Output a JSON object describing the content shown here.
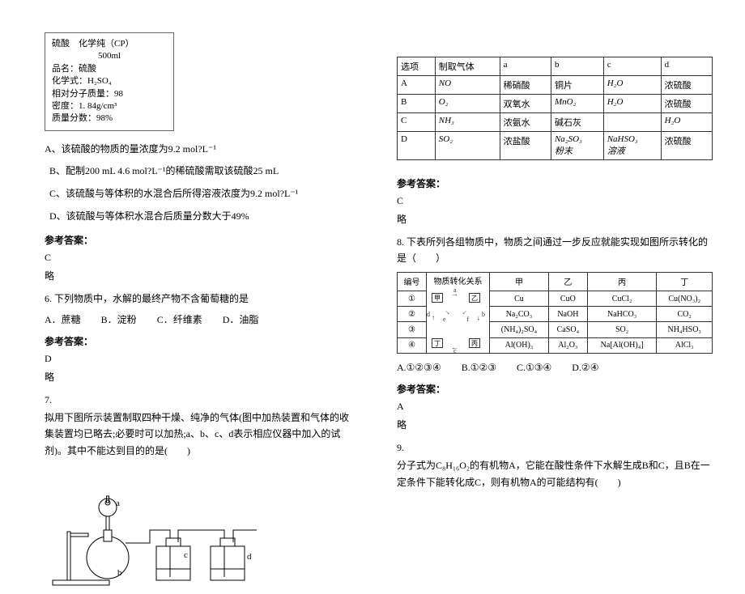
{
  "label_box": {
    "l1": "硫酸　化学纯（CP）",
    "l2": "500ml",
    "l3": "品名：硫酸",
    "l4": "化学式：H₂SO₄",
    "l5": "相对分子质量：98",
    "l6": "密度：1. 84g/cm³",
    "l7": "质量分数：98%"
  },
  "q5": {
    "A": "A、该硫酸的物质的量浓度为9.2 mol?L⁻¹",
    "B": "B、配制200 mL 4.6 mol?L⁻¹的稀硫酸需取该硫酸25 mL",
    "C": "C、该硫酸与等体积的水混合后所得溶液浓度为9.2 mol?L⁻¹",
    "D": "D、该硫酸与等体积水混合后质量分数大于49%",
    "ans_label": "参考答案：",
    "ans": "C",
    "skip": "略"
  },
  "q6": {
    "text": "6. 下列物质中，水解的最终产物不含葡萄糖的是",
    "A": "A．蔗糖",
    "B": "B．淀粉",
    "C": "C．纤维素",
    "D": "D．油脂",
    "ans_label": "参考答案：",
    "ans": "D",
    "skip": "略"
  },
  "q7": {
    "num": "7.",
    "text": "拟用下图所示装置制取四种干燥、纯净的气体(图中加热装置和气体的收集装置均已略去;必要时可以加热;a、b、c、d表示相应仪器中加入的试剂)。其中不能达到目的的是(　　)"
  },
  "gas_table": {
    "h0": "选项",
    "h1": "制取气体",
    "h2": "a",
    "h3": "b",
    "h4": "c",
    "h5": "d",
    "rows": [
      {
        "c0": "A",
        "c1": "NO",
        "c2": "稀硝酸",
        "c3": "铜片",
        "c4": "H₂O",
        "c5": "浓硫酸"
      },
      {
        "c0": "B",
        "c1": "O₂",
        "c2": "双氧水",
        "c3": "MnO₂",
        "c4": "H₂O",
        "c5": "浓硫酸"
      },
      {
        "c0": "C",
        "c1": "NH₃",
        "c2": "浓氨水",
        "c3": "碱石灰",
        "c4": "",
        "c5": "H₂O"
      },
      {
        "c0": "D",
        "c1": "SO₂",
        "c2": "浓盐酸",
        "c3": "Na₂SO₃\n粉末",
        "c4": "NaHSO₃\n溶液",
        "c5": "浓硫酸"
      }
    ],
    "ans_label": "参考答案：",
    "ans": "C",
    "skip": "略"
  },
  "q8": {
    "text": "8. 下表所列各组物质中，物质之间通过一步反应就能实现如图所示转化的是（　　）",
    "headers": {
      "h0": "编号",
      "h1": "物质转化关系",
      "h2": "甲",
      "h3": "乙",
      "h4": "丙",
      "h5": "丁"
    },
    "diagram": {
      "jia": "甲",
      "yi": "乙",
      "bing": "丙",
      "ding": "丁",
      "a": "a",
      "b": "b",
      "c": "c",
      "d": "d",
      "e": "e",
      "f": "f"
    },
    "rows": [
      {
        "n": "①",
        "c2": "Cu",
        "c3": "CuO",
        "c4": "CuCl₂",
        "c5": "Cu(NO₃)₂"
      },
      {
        "n": "②",
        "c2": "Na₂CO₃",
        "c3": "NaOH",
        "c4": "NaHCO₃",
        "c5": "CO₂"
      },
      {
        "n": "③",
        "c2": "(NH₄)₂SO₄",
        "c3": "CaSO₄",
        "c4": "SO₂",
        "c5": "NH₄HSO₃"
      },
      {
        "n": "④",
        "c2": "Al(OH)₃",
        "c3": "Al₂O₃",
        "c4": "Na[Al(OH)₄]",
        "c5": "AlCl₃"
      }
    ],
    "optA": "A.①②③④",
    "optB": "B.①②③",
    "optC": "C.①③④",
    "optD": "D.②④",
    "ans_label": "参考答案：",
    "ans": "A",
    "skip": "略"
  },
  "q9": {
    "num": "9.",
    "text": "分子式为C₈H₁₆O₂的有机物A，它能在酸性条件下水解生成B和C，且B在一定条件下能转化成C，则有机物A的可能结构有(　　)"
  },
  "apparatus": {
    "a": "a",
    "b": "b",
    "c": "c",
    "d": "d"
  }
}
